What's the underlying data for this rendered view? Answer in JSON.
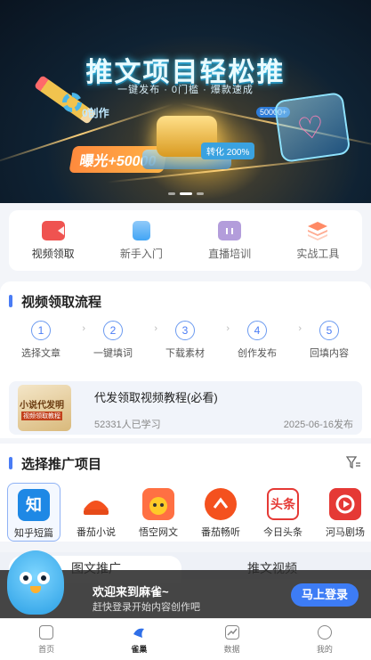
{
  "banner": {
    "title": "推文项目轻松推",
    "subtitle": "一键发布 · 0门槛 · 爆款速成",
    "tag_create": "0创作",
    "exposure": "曝光+50000",
    "convert": "转化 200%",
    "badge": "50000+",
    "slide_count": 3,
    "active_slide": 2
  },
  "quick_actions": [
    {
      "label": "视频领取",
      "icon": "video-camera-icon",
      "color": "#ef5350"
    },
    {
      "label": "新手入门",
      "icon": "book-icon",
      "color": "#64b5f6"
    },
    {
      "label": "直播培训",
      "icon": "tv-icon",
      "color": "#b39ddb"
    },
    {
      "label": "实战工具",
      "icon": "layers-icon",
      "color": "#ffab91"
    }
  ],
  "process": {
    "title": "视频领取流程",
    "steps": [
      {
        "num": "1",
        "label": "选择文章"
      },
      {
        "num": "2",
        "label": "一键填词"
      },
      {
        "num": "3",
        "label": "下载素材"
      },
      {
        "num": "4",
        "label": "创作发布"
      },
      {
        "num": "5",
        "label": "回填内容"
      }
    ],
    "tutorial": {
      "thumb_title": "小说代发明",
      "thumb_tag": "视频领取教程",
      "title": "代发领取视频教程(必看)",
      "learners": "52331人已学习",
      "date": "2025-06-16发布"
    }
  },
  "promo": {
    "title": "选择推广项目",
    "apps": [
      {
        "label": "知乎短篇",
        "logo": "知",
        "color": "#1e88e5"
      },
      {
        "label": "番茄小说",
        "logo": "",
        "color": "#f4511e"
      },
      {
        "label": "悟空网文",
        "logo": "",
        "color": "#ff7043"
      },
      {
        "label": "番茄畅听",
        "logo": "",
        "color": "#f4511e"
      },
      {
        "label": "今日头条",
        "logo": "头条",
        "color": "#e53935"
      },
      {
        "label": "河马剧场",
        "logo": "",
        "color": "#e53935"
      }
    ]
  },
  "tabs": {
    "left": "图文推广",
    "right": "推文视频"
  },
  "login": {
    "welcome": "欢迎来到麻雀~",
    "sub": "赶快登录开始内容创作吧",
    "button": "马上登录"
  },
  "nav": [
    {
      "label": "首页",
      "icon": "home-icon"
    },
    {
      "label": "雀巢",
      "icon": "sparrow-icon"
    },
    {
      "label": "数据",
      "icon": "chart-icon"
    },
    {
      "label": "我的",
      "icon": "profile-icon"
    }
  ]
}
